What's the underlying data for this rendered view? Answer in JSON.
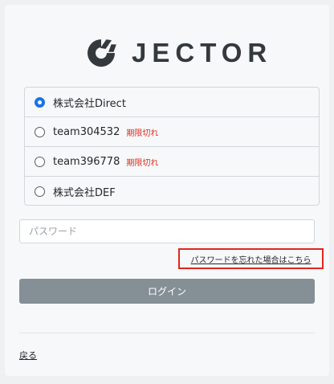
{
  "logo": {
    "text": "JECTOR",
    "mark_color": "#34393e",
    "icon": "jector-logo-icon"
  },
  "teams": [
    {
      "name": "株式会社Direct",
      "selected": true,
      "status": ""
    },
    {
      "name": "team304532",
      "selected": false,
      "status": "期限切れ"
    },
    {
      "name": "team396778",
      "selected": false,
      "status": "期限切れ"
    },
    {
      "name": "株式会社DEF",
      "selected": false,
      "status": ""
    }
  ],
  "password": {
    "placeholder": "パスワード",
    "value": ""
  },
  "forgot_password": {
    "label": "パスワードを忘れた場合はこちら"
  },
  "login_button": {
    "label": "ログイン",
    "color": "#848f96"
  },
  "back_link": {
    "label": "戻る"
  },
  "colors": {
    "expired": "#e0271d",
    "highlight_border": "#e0271d",
    "radio_selected": "#1a73e8"
  }
}
